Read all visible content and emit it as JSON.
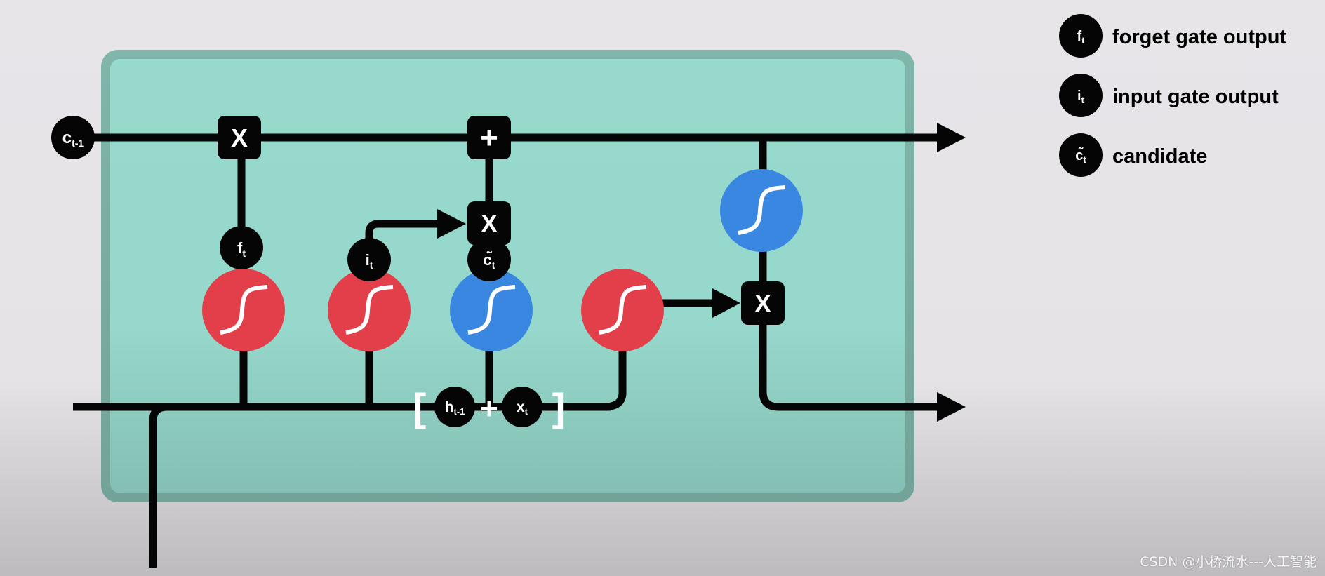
{
  "colors": {
    "cell_fill": "#97dacd",
    "cell_border": "#80b7ab",
    "sigmoid": "#e23f4b",
    "tanh": "#3a87e2",
    "line": "#050505"
  },
  "nodes": {
    "c_prev": {
      "base": "c",
      "sub": "t-1"
    },
    "f": {
      "base": "f",
      "sub": "t"
    },
    "i": {
      "base": "i",
      "sub": "t"
    },
    "c_tilde": {
      "base": "c̃",
      "sub": "t"
    },
    "h_prev": {
      "base": "h",
      "sub": "t-1"
    },
    "x": {
      "base": "x",
      "sub": "t"
    }
  },
  "operators": {
    "mul": "X",
    "add": "+",
    "concat_plus": "+",
    "bracket_open": "[",
    "bracket_close": "]"
  },
  "icons": {
    "sigmoid": "s-curve-icon",
    "tanh": "s-curve-icon"
  },
  "legend": [
    {
      "base": "f",
      "sub": "t",
      "label": "forget gate output"
    },
    {
      "base": "i",
      "sub": "t",
      "label": "input gate output"
    },
    {
      "base": "c̃",
      "sub": "t",
      "label": "candidate"
    }
  ],
  "watermark": "CSDN @小桥流水---人工智能"
}
